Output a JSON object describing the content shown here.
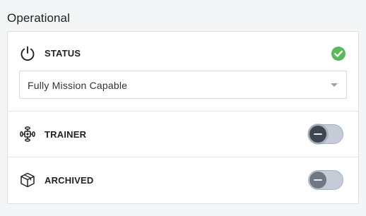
{
  "section": {
    "title": "Operational"
  },
  "status": {
    "label": "STATUS",
    "icon": "power-icon",
    "indicator_icon": "check-circle-icon",
    "indicator_color": "#5cb85c",
    "select": {
      "value": "Fully Mission Capable"
    }
  },
  "trainer": {
    "label": "TRAINER",
    "icon": "drone-icon",
    "toggle_on": false
  },
  "archived": {
    "label": "ARCHIVED",
    "icon": "box-icon",
    "toggle_on": false
  },
  "colors": {
    "toggle_track": "#c5ccd8",
    "toggle_knob": "#4f5762"
  }
}
